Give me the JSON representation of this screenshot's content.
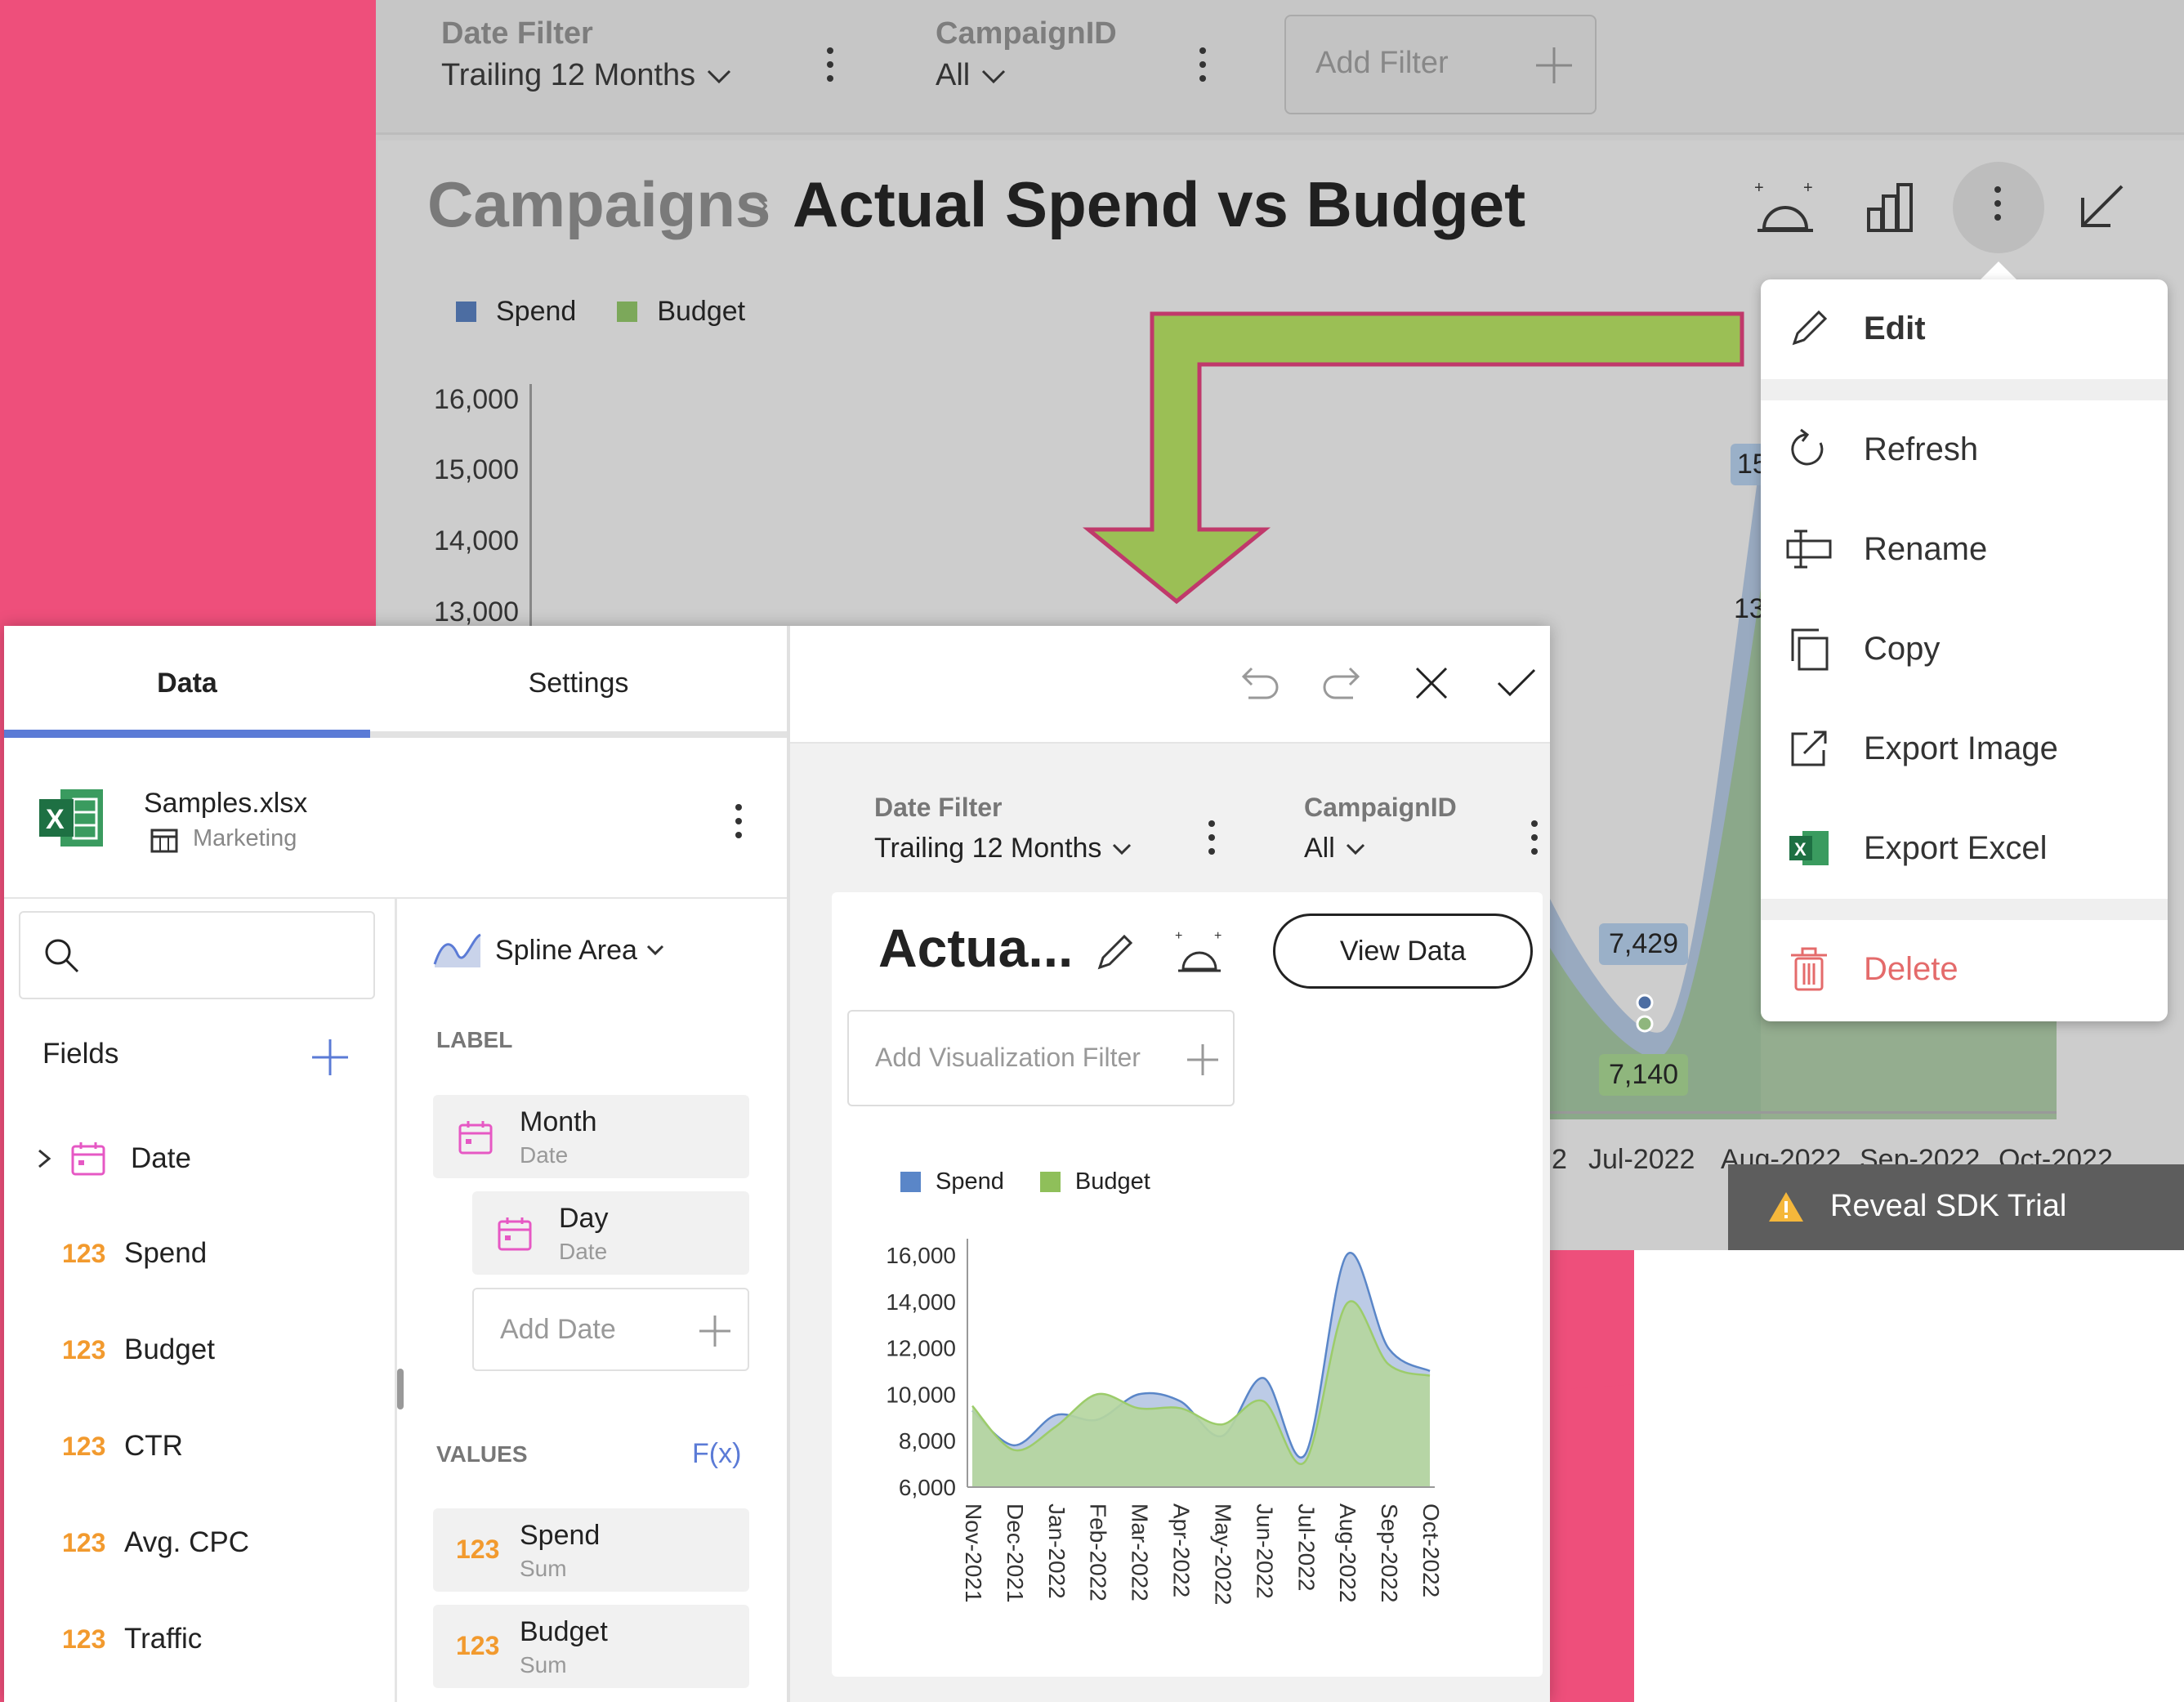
{
  "colors": {
    "pink": "#ee4f7b",
    "spend": "#5a86c8",
    "budget": "#8fbf5a",
    "accent_blue": "#5b7bd6",
    "delete_red": "#e46b6b",
    "arrow_green": "#9bbf55",
    "arrow_border": "#c0396b"
  },
  "background_dashboard": {
    "filters": [
      {
        "label": "Date Filter",
        "value": "Trailing 12 Months"
      },
      {
        "label": "CampaignID",
        "value": "All"
      }
    ],
    "add_filter_label": "Add Filter",
    "breadcrumb": "Campaigns",
    "title": "Actual Spend vs Budget",
    "legend": [
      "Spend",
      "Budget"
    ],
    "y_ticks": [
      "16,000",
      "15,000",
      "14,000",
      "13,000"
    ],
    "x_ticks": [
      "2",
      "Jul-2022",
      "Aug-2022",
      "Sep-2022",
      "Oct-2022"
    ],
    "data_labels": [
      "7,429",
      "7,140",
      "15",
      "13"
    ],
    "sdk_trial_label": "Reveal SDK Trial",
    "toolbar_icons": [
      "ai-insights-icon",
      "bar-chart-icon",
      "more-vertical-icon",
      "minimize-icon"
    ]
  },
  "context_menu": {
    "items": [
      {
        "label": "Edit",
        "icon": "pencil-icon"
      },
      {
        "label": "Refresh",
        "icon": "refresh-icon"
      },
      {
        "label": "Rename",
        "icon": "rename-icon"
      },
      {
        "label": "Copy",
        "icon": "copy-icon"
      },
      {
        "label": "Export Image",
        "icon": "export-image-icon"
      },
      {
        "label": "Export Excel",
        "icon": "excel-icon"
      },
      {
        "label": "Delete",
        "icon": "trash-icon"
      }
    ]
  },
  "editor": {
    "tabs": [
      "Data",
      "Settings"
    ],
    "active_tab": "Data",
    "datasource": {
      "file": "Samples.xlsx",
      "sheet": "Marketing"
    },
    "fields_label": "Fields",
    "fields": [
      {
        "type": "date",
        "label": "Date"
      },
      {
        "type": "123",
        "label": "Spend"
      },
      {
        "type": "123",
        "label": "Budget"
      },
      {
        "type": "123",
        "label": "CTR"
      },
      {
        "type": "123",
        "label": "Avg. CPC"
      },
      {
        "type": "123",
        "label": "Traffic"
      }
    ],
    "chart_type": "Spline Area",
    "label_section": "LABEL",
    "label_pills": [
      {
        "main": "Month",
        "sub": "Date"
      },
      {
        "main": "Day",
        "sub": "Date"
      }
    ],
    "add_date_label": "Add Date",
    "values_section": "VALUES",
    "fx_label": "F(x)",
    "value_pills": [
      {
        "icon": "123",
        "main": "Spend",
        "sub": "Sum"
      },
      {
        "icon": "123",
        "main": "Budget",
        "sub": "Sum"
      }
    ],
    "preview": {
      "filters": [
        {
          "label": "Date Filter",
          "value": "Trailing 12 Months"
        },
        {
          "label": "CampaignID",
          "value": "All"
        }
      ],
      "title": "Actua...",
      "view_data_label": "View Data",
      "add_viz_filter_label": "Add Visualization Filter"
    }
  },
  "chart_data": {
    "type": "area",
    "subtype": "spline-area",
    "title": "",
    "legend": [
      "Spend",
      "Budget"
    ],
    "legend_position": "top-left",
    "categories": [
      "Nov-2021",
      "Dec-2021",
      "Jan-2022",
      "Feb-2022",
      "Mar-2022",
      "Apr-2022",
      "May-2022",
      "Jun-2022",
      "Jul-2022",
      "Aug-2022",
      "Sep-2022",
      "Oct-2022"
    ],
    "series": [
      {
        "name": "Spend",
        "values": [
          9300,
          7800,
          9100,
          8900,
          10000,
          9700,
          8200,
          10700,
          7400,
          16000,
          12000,
          11000
        ]
      },
      {
        "name": "Budget",
        "values": [
          9500,
          7600,
          8600,
          10000,
          9400,
          9400,
          8700,
          9700,
          7100,
          13900,
          11300,
          10800
        ]
      }
    ],
    "y_ticks": [
      "16,000",
      "14,000",
      "12,000",
      "10,000",
      "8,000",
      "6,000"
    ],
    "ylim": [
      6000,
      16000
    ],
    "grid": false
  }
}
